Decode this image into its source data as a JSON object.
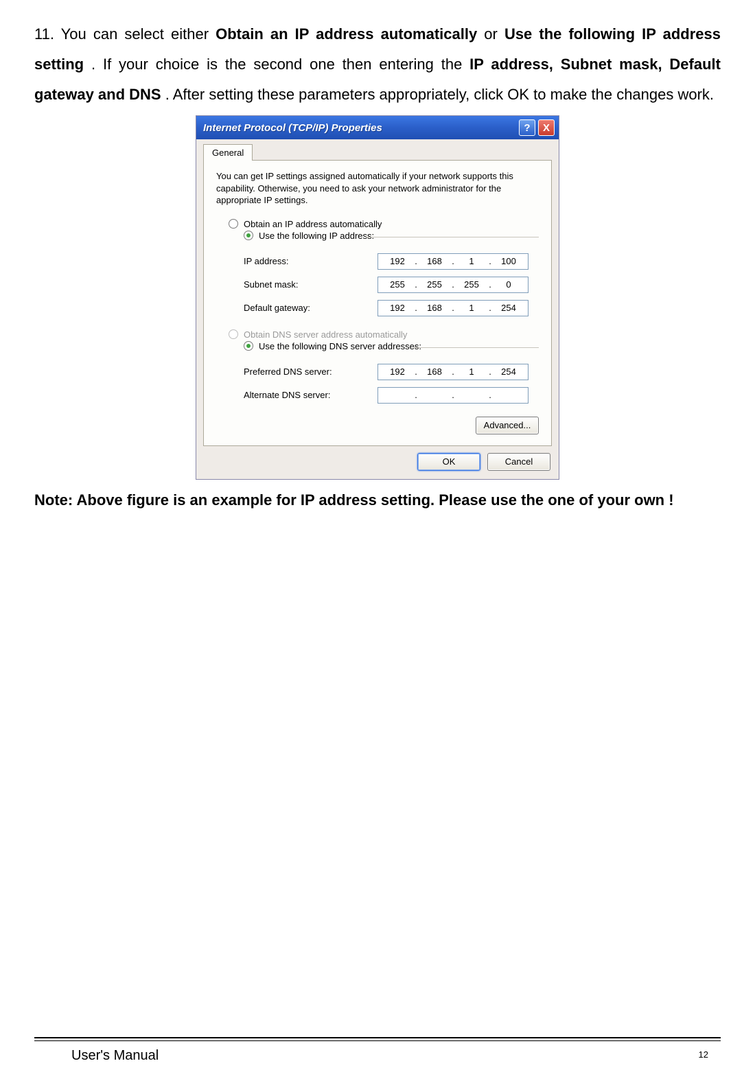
{
  "paragraph": {
    "prefix": "11. You can select either ",
    "b1": "Obtain an IP address automatically",
    "mid1": " or ",
    "b2": "Use the following IP address setting",
    "mid2": ". If your choice is the second one then entering the ",
    "b3": "IP address, Subnet mask, Default  gateway and DNS",
    "suffix": ". After setting these parameters appropriately, click OK to make the changes work."
  },
  "dialog": {
    "title": "Internet Protocol (TCP/IP) Properties",
    "help_symbol": "?",
    "close_symbol": "X",
    "tab_general": "General",
    "description": "You can get IP settings assigned automatically if your network supports this capability. Otherwise, you need to ask your network administrator for the appropriate IP settings.",
    "radio_auto_ip": "Obtain an IP address automatically",
    "radio_use_ip": "Use the following IP address:",
    "fields_ip": {
      "ip_label": "IP address:",
      "ip": [
        "192",
        "168",
        "1",
        "100"
      ],
      "subnet_label": "Subnet mask:",
      "subnet": [
        "255",
        "255",
        "255",
        "0"
      ],
      "gateway_label": "Default gateway:",
      "gateway": [
        "192",
        "168",
        "1",
        "254"
      ]
    },
    "radio_auto_dns": "Obtain DNS server address automatically",
    "radio_use_dns": "Use the following DNS server addresses:",
    "fields_dns": {
      "pref_label": "Preferred DNS server:",
      "pref": [
        "192",
        "168",
        "1",
        "254"
      ],
      "alt_label": "Alternate DNS server:",
      "alt": [
        "",
        "",
        "",
        ""
      ]
    },
    "advanced_btn": "Advanced...",
    "ok_btn": "OK",
    "cancel_btn": "Cancel"
  },
  "note": "Note: Above figure is an example for IP address setting. Please use the one of your own !",
  "footer": {
    "label": "User's Manual",
    "page": "12"
  },
  "dot": "."
}
